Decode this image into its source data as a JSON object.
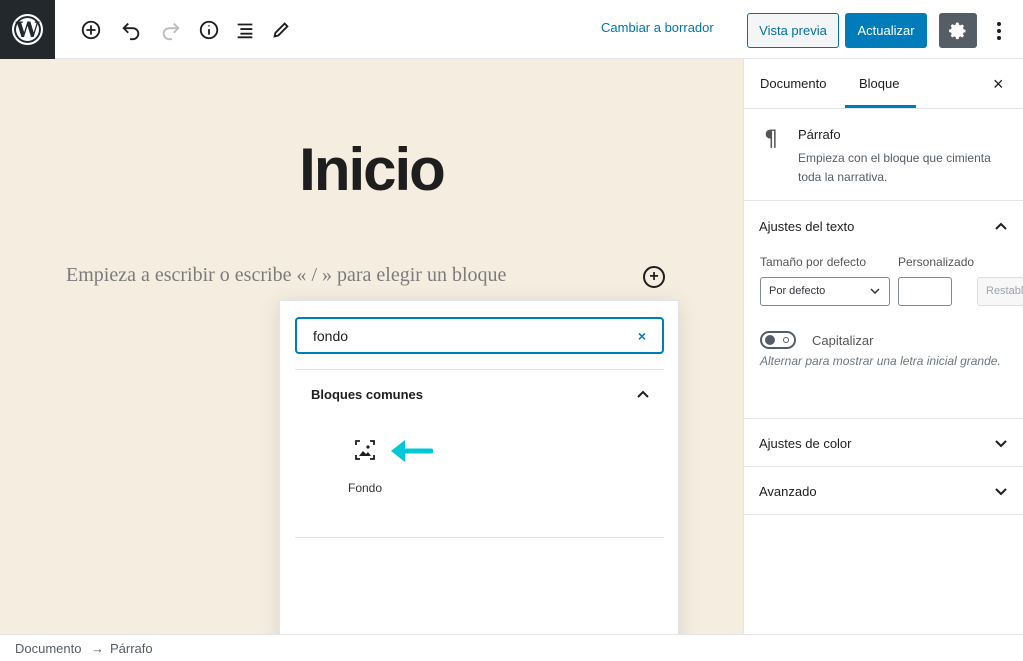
{
  "toolbar": {
    "logo_icon": "wordpress-logo",
    "tools": [
      "add-block-icon",
      "undo-icon",
      "redo-icon",
      "info-icon",
      "list-view-icon",
      "edit-icon"
    ],
    "switch_draft": "Cambiar a borrador",
    "preview": "Vista previa",
    "update": "Actualizar",
    "accent": "#007cba"
  },
  "editor": {
    "title": "Inicio",
    "placeholder": "Empieza a escribir o escribe « / » para elegir un bloque",
    "background": "#f4ede0"
  },
  "inserter": {
    "search_value": "fondo",
    "clear": "×",
    "section_title": "Bloques comunes",
    "blocks": [
      {
        "label": "Fondo",
        "icon": "cover-image-icon"
      }
    ],
    "arrow_color": "#00c8d7"
  },
  "sidebar": {
    "tabs": [
      "Documento",
      "Bloque"
    ],
    "active_tab": "Bloque",
    "close": "×",
    "block_card": {
      "icon": "¶",
      "title": "Párrafo",
      "description": "Empieza con el bloque que cimienta toda la narrativa."
    },
    "panels": {
      "text_settings": "Ajustes del texto",
      "default_size_label": "Tamaño por defecto",
      "custom_label": "Personalizado",
      "size_value": "Por defecto",
      "reset": "Restablecer",
      "drop_cap_label": "Capitalizar",
      "drop_cap_help": "Alternar para mostrar una letra inicial grande.",
      "color_settings": "Ajustes de color",
      "advanced": "Avanzado"
    }
  },
  "footer": {
    "crumb1": "Documento",
    "sep": "→",
    "crumb2": "Párrafo"
  }
}
